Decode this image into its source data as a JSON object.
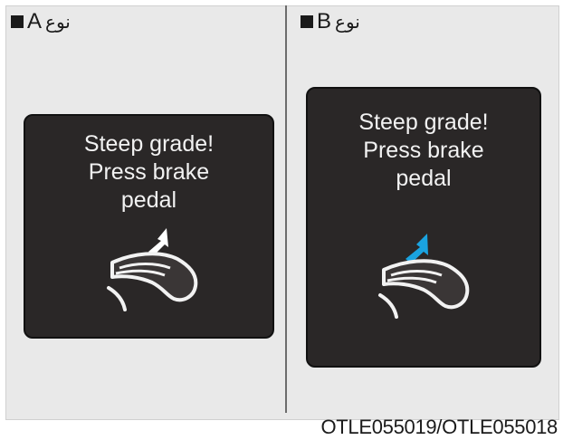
{
  "panels": [
    {
      "type_letter": "A",
      "type_word": "نوع",
      "message": "Steep grade!\nPress brake\npedal",
      "arrow_color": "#ffffff"
    },
    {
      "type_letter": "B",
      "type_word": "نوع",
      "message": "Steep grade!\nPress brake\npedal",
      "arrow_color": "#1aa3e0"
    }
  ],
  "caption": "OTLE055019/OTLE055018",
  "icons": [
    "brake-pedal-icon",
    "press-arrow-icon",
    "square-bullet-icon"
  ]
}
